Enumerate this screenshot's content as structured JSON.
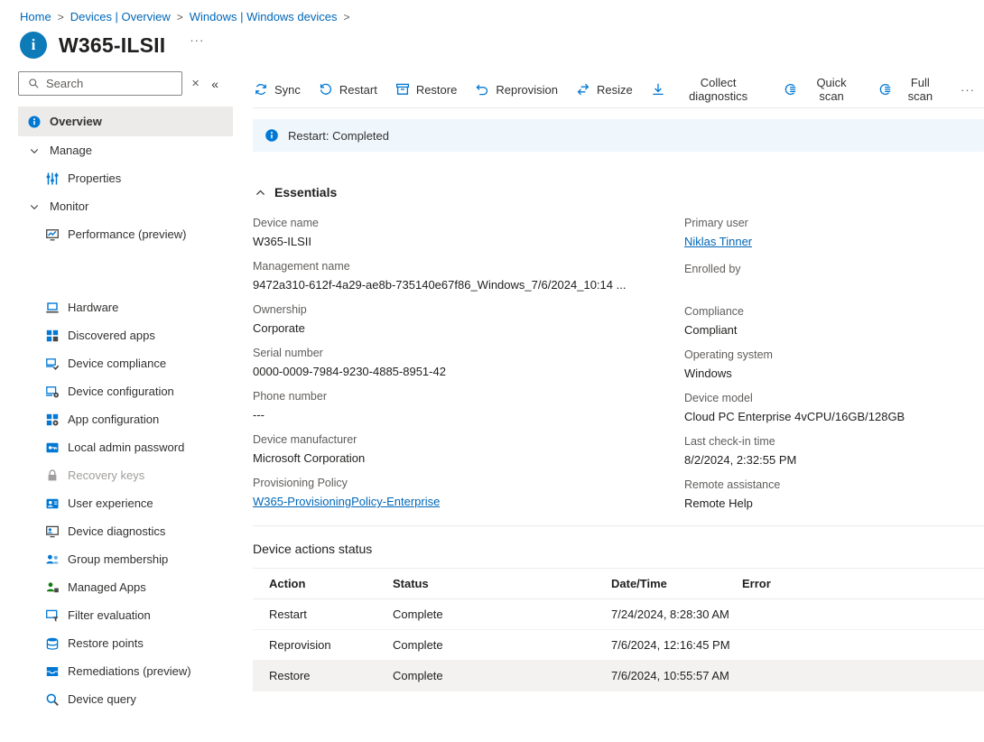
{
  "breadcrumb": {
    "separator": ">",
    "items": [
      {
        "label": "Home"
      },
      {
        "label": "Devices | Overview"
      },
      {
        "label": "Windows | Windows devices"
      }
    ]
  },
  "header": {
    "title": "W365-ILSII",
    "more_label": "···"
  },
  "sidebar": {
    "search_placeholder": "Search",
    "dismiss_label": "✕",
    "collapse_label": "«",
    "items": [
      {
        "label": "Overview",
        "icon": "overview-info-icon",
        "selected": true
      },
      {
        "label": "Manage",
        "type": "group",
        "icon": "chevron-down-icon"
      },
      {
        "label": "Properties",
        "icon": "properties-icon",
        "indent": true
      },
      {
        "label": "Monitor",
        "type": "group",
        "icon": "chevron-down-icon"
      },
      {
        "label": "Performance (preview)",
        "icon": "performance-icon",
        "indent": true
      },
      {
        "type": "spacer"
      },
      {
        "label": "Hardware",
        "icon": "hardware-icon",
        "indent": true
      },
      {
        "label": "Discovered apps",
        "icon": "discovered-apps-icon",
        "indent": true
      },
      {
        "label": "Device compliance",
        "icon": "device-compliance-icon",
        "indent": true
      },
      {
        "label": "Device configuration",
        "icon": "device-configuration-icon",
        "indent": true
      },
      {
        "label": "App configuration",
        "icon": "app-configuration-icon",
        "indent": true
      },
      {
        "label": "Local admin password",
        "icon": "local-admin-password-icon",
        "indent": true
      },
      {
        "label": "Recovery keys",
        "icon": "recovery-keys-icon",
        "indent": true,
        "disabled": true
      },
      {
        "label": "User experience",
        "icon": "user-experience-icon",
        "indent": true
      },
      {
        "label": "Device diagnostics",
        "icon": "device-diagnostics-icon",
        "indent": true
      },
      {
        "label": "Group membership",
        "icon": "group-membership-icon",
        "indent": true
      },
      {
        "label": "Managed Apps",
        "icon": "managed-apps-icon",
        "indent": true
      },
      {
        "label": "Filter evaluation",
        "icon": "filter-evaluation-icon",
        "indent": true
      },
      {
        "label": "Restore points",
        "icon": "restore-points-icon",
        "indent": true
      },
      {
        "label": "Remediations (preview)",
        "icon": "remediations-icon",
        "indent": true
      },
      {
        "label": "Device query",
        "icon": "device-query-icon",
        "indent": true
      }
    ]
  },
  "toolbar": {
    "actions": [
      {
        "label": "Sync",
        "icon": "sync-icon"
      },
      {
        "label": "Restart",
        "icon": "restart-icon"
      },
      {
        "label": "Restore",
        "icon": "restore-icon"
      },
      {
        "label": "Reprovision",
        "icon": "reprovision-icon"
      },
      {
        "label": "Resize",
        "icon": "resize-icon"
      },
      {
        "label": "Collect diagnostics",
        "icon": "collect-diagnostics-icon"
      },
      {
        "label": "Quick scan",
        "icon": "quick-scan-icon"
      },
      {
        "label": "Full scan",
        "icon": "full-scan-icon"
      }
    ],
    "more_label": "···"
  },
  "banner": {
    "text": "Restart: Completed"
  },
  "essentials": {
    "title": "Essentials",
    "left": [
      {
        "label": "Device name",
        "value": "W365-ILSII"
      },
      {
        "label": "Management name",
        "value": "9472a310-612f-4a29-ae8b-735140e67f86_Windows_7/6/2024_10:14 ..."
      },
      {
        "label": "Ownership",
        "value": "Corporate"
      },
      {
        "label": "Serial number",
        "value": "0000-0009-7984-9230-4885-8951-42"
      },
      {
        "label": "Phone number",
        "value": "---"
      },
      {
        "label": "Device manufacturer",
        "value": "Microsoft Corporation"
      },
      {
        "label": "Provisioning Policy",
        "value": "W365-ProvisioningPolicy-Enterprise",
        "link": true
      }
    ],
    "right": [
      {
        "label": "Primary user",
        "value": "Niklas Tinner",
        "link": true
      },
      {
        "label": "Enrolled by",
        "value": ""
      },
      {
        "label": "Compliance",
        "value": "Compliant"
      },
      {
        "label": "Operating system",
        "value": "Windows"
      },
      {
        "label": "Device model",
        "value": "Cloud PC Enterprise 4vCPU/16GB/128GB"
      },
      {
        "label": "Last check-in time",
        "value": "8/2/2024, 2:32:55 PM"
      },
      {
        "label": "Remote assistance",
        "value": "Remote Help"
      }
    ]
  },
  "actions_status": {
    "title": "Device actions status",
    "columns": [
      "Action",
      "Status",
      "Date/Time",
      "Error"
    ],
    "rows": [
      {
        "action": "Restart",
        "status": "Complete",
        "datetime": "7/24/2024, 8:28:30 AM",
        "error": "",
        "highlighted": false
      },
      {
        "action": "Reprovision",
        "status": "Complete",
        "datetime": "7/6/2024, 12:16:45 PM",
        "error": "",
        "highlighted": false
      },
      {
        "action": "Restore",
        "status": "Complete",
        "datetime": "7/6/2024, 10:55:57 AM",
        "error": "",
        "highlighted": true
      }
    ]
  }
}
